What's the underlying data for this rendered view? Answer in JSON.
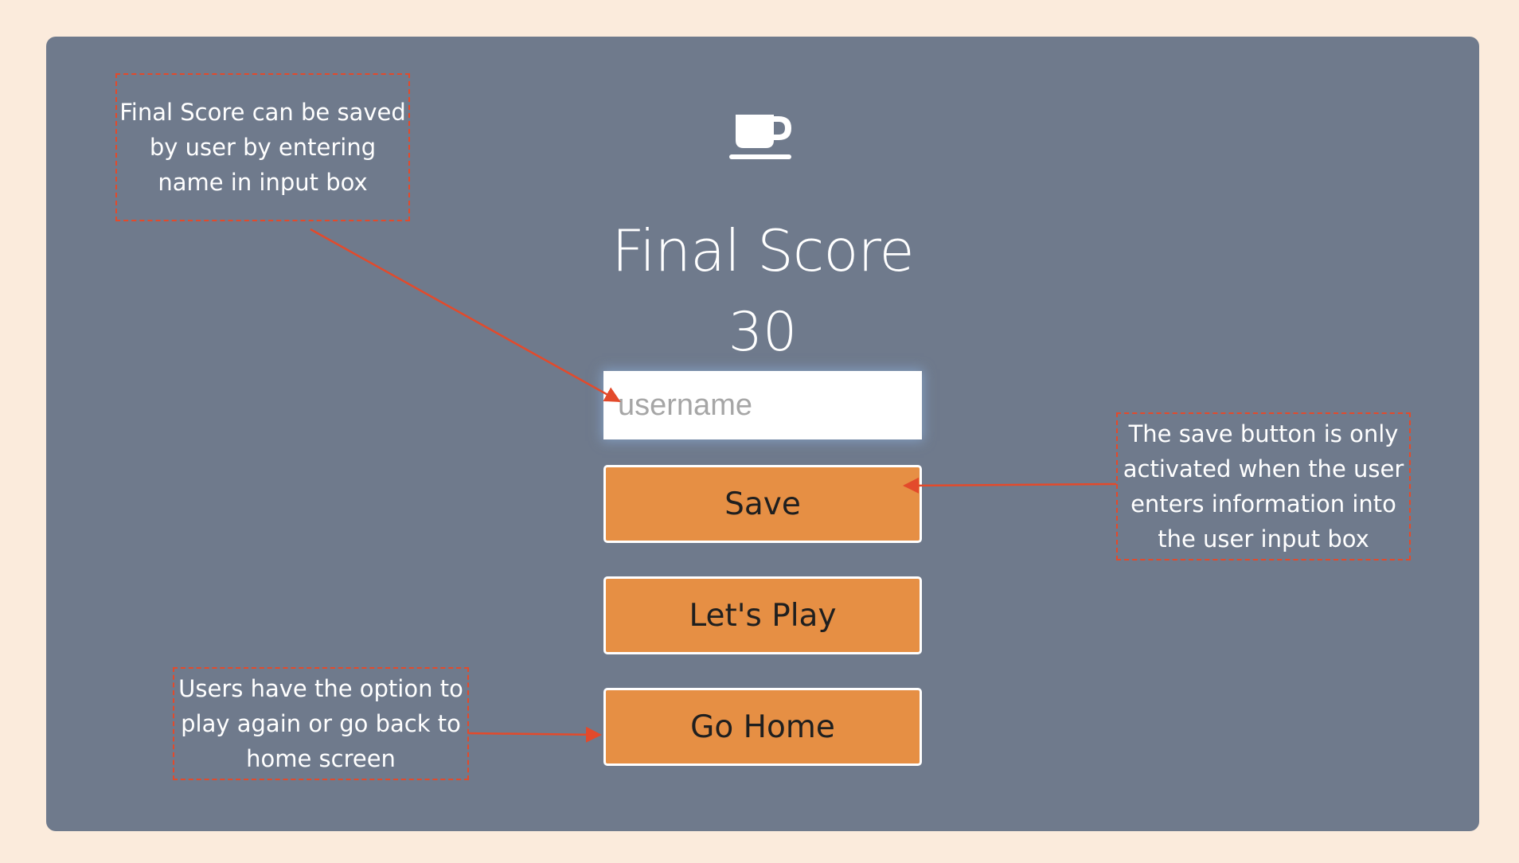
{
  "screen": {
    "title": "Final Score",
    "score": "30",
    "username_placeholder": "username",
    "save_label": "Save",
    "play_label": "Let's Play",
    "home_label": "Go Home",
    "icon": "coffee-cup-icon"
  },
  "annotations": {
    "input_note": "Final Score can be saved by user by entering name in input box",
    "save_note": "The save button is only activated when the user enters information into the user input box",
    "nav_note": "Users have the option to play again or go back to home screen"
  },
  "colors": {
    "page_background": "#fbebdc",
    "panel_background": "#6f7a8c",
    "button_background": "#e68f44",
    "annotation_color": "#e34a2b"
  }
}
